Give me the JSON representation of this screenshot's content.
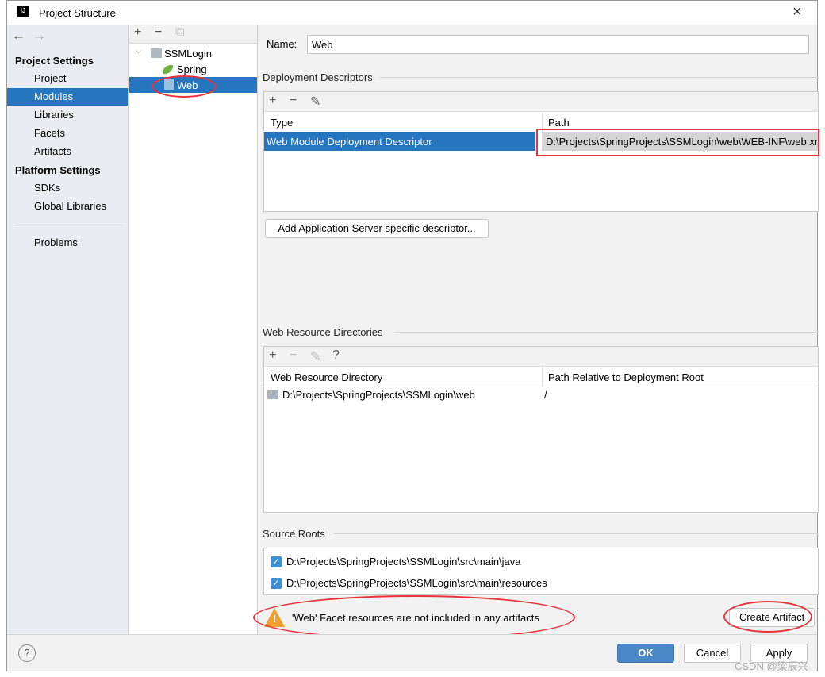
{
  "window": {
    "title": "Project Structure",
    "logo": "IJ"
  },
  "nav": {
    "back": "←",
    "forward": "→"
  },
  "sidebar": {
    "project_settings": "Project Settings",
    "items1": [
      "Project",
      "Modules",
      "Libraries",
      "Facets",
      "Artifacts"
    ],
    "platform_settings": "Platform Settings",
    "items2": [
      "SDKs",
      "Global Libraries"
    ],
    "problems": "Problems",
    "selected": "Modules"
  },
  "tree": {
    "toolbar": [
      "+",
      "−",
      "⧉"
    ],
    "root": "SSMLogin",
    "children": [
      "Spring",
      "Web"
    ],
    "selected": "Web"
  },
  "main": {
    "name_label": "Name:",
    "name_value": "Web",
    "deployment": {
      "title": "Deployment Descriptors",
      "toolbar": [
        "+",
        "−",
        "✎"
      ],
      "headers": [
        "Type",
        "Path"
      ],
      "rows": [
        [
          "Web Module Deployment Descriptor",
          "D:\\Projects\\SpringProjects\\SSMLogin\\web\\WEB-INF\\web.xml"
        ]
      ],
      "add_button": "Add Application Server specific descriptor..."
    },
    "resources": {
      "title": "Web Resource Directories",
      "toolbar": [
        "+",
        "−",
        "✎",
        "?"
      ],
      "headers": [
        "Web Resource Directory",
        "Path Relative to Deployment Root"
      ],
      "rows": [
        [
          "D:\\Projects\\SpringProjects\\SSMLogin\\web",
          "/"
        ]
      ]
    },
    "source_roots": {
      "title": "Source Roots",
      "items": [
        "D:\\Projects\\SpringProjects\\SSMLogin\\src\\main\\java",
        "D:\\Projects\\SpringProjects\\SSMLogin\\src\\main\\resources"
      ]
    },
    "warning": "'Web' Facet resources are not included in any artifacts",
    "create_artifact": "Create Artifact"
  },
  "footer": {
    "help": "?",
    "ok": "OK",
    "cancel": "Cancel",
    "apply": "Apply",
    "watermark": "CSDN @梁辰兴"
  },
  "colors": {
    "selection": "#2675bf",
    "annotation": "#e8333a",
    "ok": "#4a88c7"
  }
}
